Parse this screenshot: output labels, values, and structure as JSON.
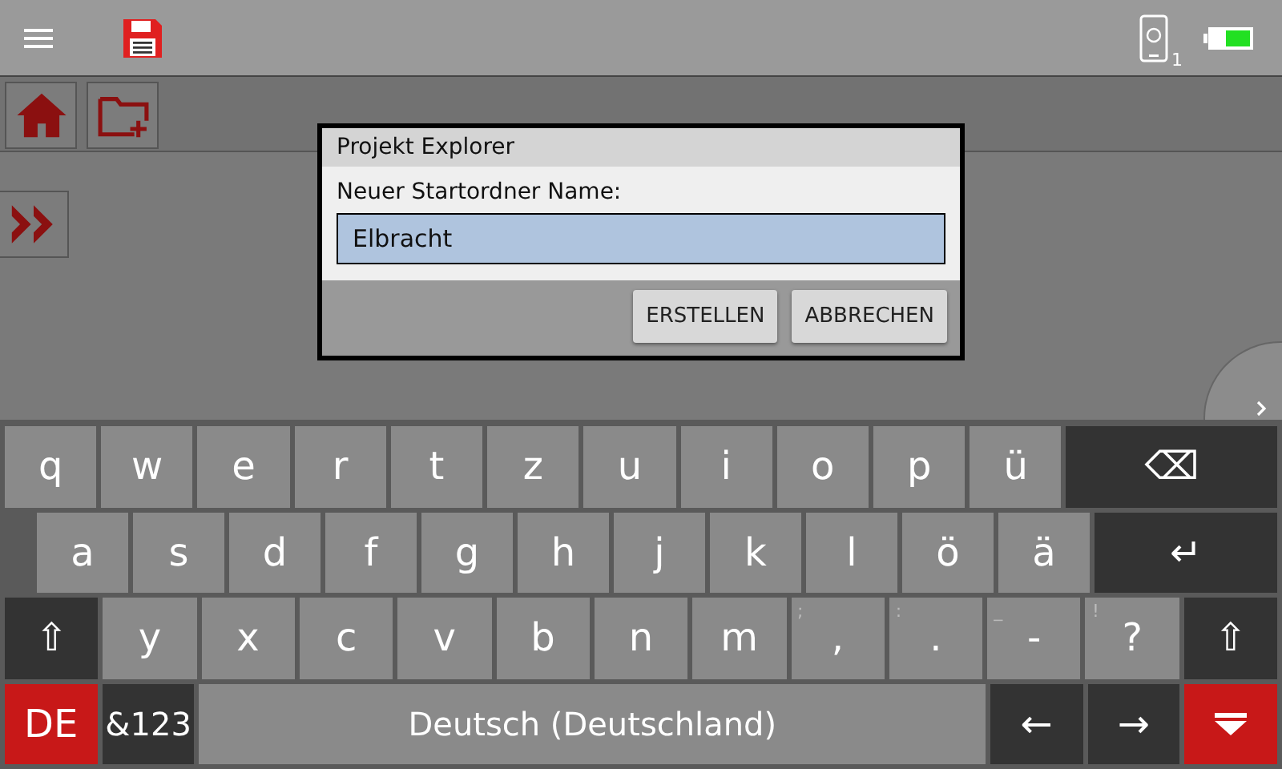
{
  "status_bar": {
    "device_badge": "1"
  },
  "dialog": {
    "title": "Projekt Explorer",
    "label": "Neuer Startordner Name:",
    "field": {
      "value": "Elbracht"
    },
    "buttons": [
      "ERSTELLEN",
      "ABBRECHEN"
    ]
  },
  "keyboard": {
    "rows": [
      {
        "keys": [
          {
            "label": "q",
            "kind": "char"
          },
          {
            "label": "w",
            "kind": "char"
          },
          {
            "label": "e",
            "kind": "char"
          },
          {
            "label": "r",
            "kind": "char"
          },
          {
            "label": "t",
            "kind": "char"
          },
          {
            "label": "z",
            "kind": "char"
          },
          {
            "label": "u",
            "kind": "char"
          },
          {
            "label": "i",
            "kind": "char"
          },
          {
            "label": "o",
            "kind": "char"
          },
          {
            "label": "p",
            "kind": "char"
          },
          {
            "label": "ü",
            "kind": "char"
          },
          {
            "label": "⌫",
            "kind": "backspace"
          }
        ]
      },
      {
        "keys": [
          {
            "label": "a",
            "kind": "char"
          },
          {
            "label": "s",
            "kind": "char"
          },
          {
            "label": "d",
            "kind": "char"
          },
          {
            "label": "f",
            "kind": "char"
          },
          {
            "label": "g",
            "kind": "char"
          },
          {
            "label": "h",
            "kind": "char"
          },
          {
            "label": "j",
            "kind": "char"
          },
          {
            "label": "k",
            "kind": "char"
          },
          {
            "label": "l",
            "kind": "char"
          },
          {
            "label": "ö",
            "kind": "char"
          },
          {
            "label": "ä",
            "kind": "char"
          },
          {
            "label": "↵",
            "kind": "enter"
          }
        ]
      },
      {
        "keys": [
          {
            "label": "⇧",
            "kind": "shift"
          },
          {
            "label": "y",
            "kind": "char"
          },
          {
            "label": "x",
            "kind": "char"
          },
          {
            "label": "c",
            "kind": "char"
          },
          {
            "label": "v",
            "kind": "char"
          },
          {
            "label": "b",
            "kind": "char"
          },
          {
            "label": "n",
            "kind": "char"
          },
          {
            "label": "m",
            "kind": "char"
          },
          {
            "label": ",",
            "hint": ";",
            "kind": "char"
          },
          {
            "label": ".",
            "hint": ":",
            "kind": "char"
          },
          {
            "label": "-",
            "hint": "_",
            "kind": "char"
          },
          {
            "label": "?",
            "hint": "!",
            "kind": "char"
          },
          {
            "label": "⇧",
            "kind": "shift"
          }
        ]
      },
      {
        "keys": [
          {
            "label": "DE",
            "kind": "language"
          },
          {
            "label": "&123",
            "kind": "symbols"
          },
          {
            "label": "Deutsch (Deutschland)",
            "kind": "space"
          },
          {
            "label": "←",
            "kind": "arrow"
          },
          {
            "label": "→",
            "kind": "arrow"
          },
          {
            "kind": "hide"
          }
        ]
      }
    ]
  }
}
